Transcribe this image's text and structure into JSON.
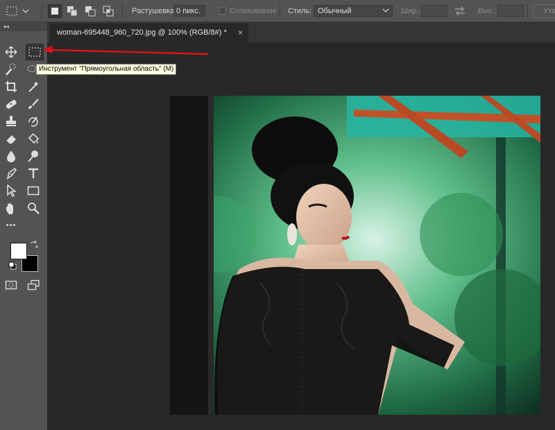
{
  "options_bar": {
    "feather_label": "Растушевка:",
    "feather_value": "0 пикс.",
    "antialias_label": "Сглаживание",
    "style_label": "Стиль:",
    "style_value": "Обычный",
    "width_label": "Шир.:",
    "height_label": "Выс.:",
    "refine_label": "Уто"
  },
  "document": {
    "tab_title": "woman-695448_960_720.jpg @ 100% (RGB/8#) *",
    "close_glyph": "×"
  },
  "toolbar": {
    "collapse_glyph": "◂◂",
    "active_tool": "rectangular-marquee",
    "foreground_color": "#ffffff",
    "background_color": "#000000",
    "more_glyph": "•••"
  },
  "tooltip": {
    "text": "Инструмент \"Прямоугольная область\" (M)"
  },
  "annotation": {
    "arrow_color": "#e0101a"
  }
}
